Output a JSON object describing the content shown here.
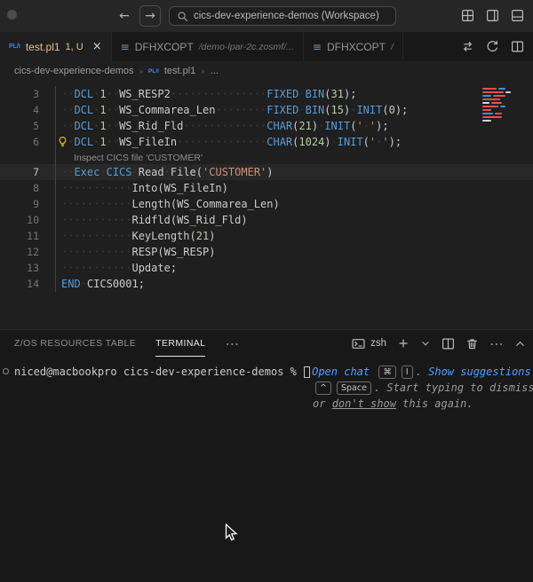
{
  "icons": {
    "back": "←",
    "forward": "→",
    "close": "×",
    "more": "⋯",
    "chevron": "›"
  },
  "colors": {
    "keyword_blue": "#569cd6",
    "number_green": "#b5cea8",
    "string_orange": "#ce9178",
    "modified_tab_gold": "#e2c08d",
    "hint_blue": "#4da0ff",
    "minimap_red": "#f14c4c",
    "accent_blue": "#3b8eea",
    "lightbulb_yellow": "#ffcc02"
  },
  "titlebar": {
    "search_text": "cics-dev-experience-demos (Workspace)"
  },
  "tabs": [
    {
      "icon": "PL/I",
      "label": "test.pl1",
      "badge": "1, U",
      "active": true
    },
    {
      "icon": "≡",
      "label": "DFHXCOPT",
      "desc": "/demo-lpar-2c.zosmf/...",
      "active": false
    },
    {
      "icon": "≡",
      "label": "DFHXCOPT",
      "desc": "/",
      "active": false
    }
  ],
  "breadcrumb": [
    {
      "label": "cics-dev-experience-demos"
    },
    {
      "label": "test.pl1",
      "icon": "PL/I"
    },
    {
      "label": "..."
    }
  ],
  "editor": {
    "rows": [
      {
        "type": "code",
        "num": "3",
        "seg": [
          [
            "ws",
            "··"
          ],
          [
            "kw",
            "DCL"
          ],
          [
            "ws",
            "·"
          ],
          [
            "num",
            "1"
          ],
          [
            "ws",
            "··"
          ],
          [
            "id",
            "WS_RESP2"
          ],
          [
            "ws",
            "···············"
          ],
          [
            "kw",
            "FIXED"
          ],
          [
            "ws",
            "·"
          ],
          [
            "kw",
            "BIN"
          ],
          [
            "pun",
            "("
          ],
          [
            "num",
            "31"
          ],
          [
            "pun",
            ");"
          ]
        ]
      },
      {
        "type": "code",
        "num": "4",
        "seg": [
          [
            "ws",
            "··"
          ],
          [
            "kw",
            "DCL"
          ],
          [
            "ws",
            "·"
          ],
          [
            "num",
            "1"
          ],
          [
            "ws",
            "··"
          ],
          [
            "id",
            "WS_Commarea_Len"
          ],
          [
            "ws",
            "········"
          ],
          [
            "kw",
            "FIXED"
          ],
          [
            "ws",
            "·"
          ],
          [
            "kw",
            "BIN"
          ],
          [
            "pun",
            "("
          ],
          [
            "num",
            "15"
          ],
          [
            "pun",
            ")"
          ],
          [
            "ws",
            "·"
          ],
          [
            "kw",
            "INIT"
          ],
          [
            "pun",
            "("
          ],
          [
            "num",
            "0"
          ],
          [
            "pun",
            ");"
          ]
        ]
      },
      {
        "type": "code",
        "num": "5",
        "seg": [
          [
            "ws",
            "··"
          ],
          [
            "kw",
            "DCL"
          ],
          [
            "ws",
            "·"
          ],
          [
            "num",
            "1"
          ],
          [
            "ws",
            "··"
          ],
          [
            "id",
            "WS_Rid_Fld"
          ],
          [
            "ws",
            "·············"
          ],
          [
            "kw",
            "CHAR"
          ],
          [
            "pun",
            "("
          ],
          [
            "num",
            "21"
          ],
          [
            "pun",
            ")"
          ],
          [
            "ws",
            "·"
          ],
          [
            "kw",
            "INIT"
          ],
          [
            "pun",
            "("
          ],
          [
            "str",
            "'"
          ],
          [
            "ws",
            "·"
          ],
          [
            "str",
            "'"
          ],
          [
            "pun",
            ");"
          ]
        ]
      },
      {
        "type": "code",
        "num": "6",
        "bulb": true,
        "seg": [
          [
            "ws",
            "··"
          ],
          [
            "kw",
            "DCL"
          ],
          [
            "ws",
            "·"
          ],
          [
            "num",
            "1"
          ],
          [
            "ws",
            "··"
          ],
          [
            "id",
            "WS_FileIn"
          ],
          [
            "ws",
            "··············"
          ],
          [
            "kw",
            "CHAR"
          ],
          [
            "pun",
            "("
          ],
          [
            "num",
            "1024"
          ],
          [
            "pun",
            ")"
          ],
          [
            "ws",
            "·"
          ],
          [
            "kw",
            "INIT"
          ],
          [
            "pun",
            "("
          ],
          [
            "str",
            "'"
          ],
          [
            "ws",
            "·"
          ],
          [
            "str",
            "'"
          ],
          [
            "pun",
            ");"
          ]
        ]
      },
      {
        "type": "lens",
        "text": "Inspect CICS file 'CUSTOMER'"
      },
      {
        "type": "code",
        "num": "7",
        "current": true,
        "seg": [
          [
            "ws",
            "··"
          ],
          [
            "kw",
            "Exec"
          ],
          [
            "ws",
            "·"
          ],
          [
            "kw",
            "CICS"
          ],
          [
            "ws",
            "·"
          ],
          [
            "id",
            "Read"
          ],
          [
            "ws",
            "·"
          ],
          [
            "id",
            "File"
          ],
          [
            "pun",
            "("
          ],
          [
            "str",
            "'CUSTOMER'"
          ],
          [
            "pun",
            ")"
          ]
        ]
      },
      {
        "type": "code",
        "num": "8",
        "seg": [
          [
            "ws",
            "···········"
          ],
          [
            "id",
            "Into"
          ],
          [
            "pun",
            "("
          ],
          [
            "id",
            "WS_FileIn"
          ],
          [
            "pun",
            ")"
          ]
        ]
      },
      {
        "type": "code",
        "num": "9",
        "seg": [
          [
            "ws",
            "···········"
          ],
          [
            "id",
            "Length"
          ],
          [
            "pun",
            "("
          ],
          [
            "id",
            "WS_Commarea_Len"
          ],
          [
            "pun",
            ")"
          ]
        ]
      },
      {
        "type": "code",
        "num": "10",
        "seg": [
          [
            "ws",
            "···········"
          ],
          [
            "id",
            "Ridfld"
          ],
          [
            "pun",
            "("
          ],
          [
            "id",
            "WS_Rid_Fld"
          ],
          [
            "pun",
            ")"
          ]
        ]
      },
      {
        "type": "code",
        "num": "11",
        "seg": [
          [
            "ws",
            "···········"
          ],
          [
            "id",
            "KeyLength"
          ],
          [
            "pun",
            "("
          ],
          [
            "num",
            "21"
          ],
          [
            "pun",
            ")"
          ]
        ]
      },
      {
        "type": "code",
        "num": "12",
        "seg": [
          [
            "ws",
            "···········"
          ],
          [
            "id",
            "RESP"
          ],
          [
            "pun",
            "("
          ],
          [
            "id",
            "WS_RESP"
          ],
          [
            "pun",
            ")"
          ]
        ]
      },
      {
        "type": "code",
        "num": "13",
        "seg": [
          [
            "ws",
            "···········"
          ],
          [
            "id",
            "Update"
          ],
          [
            "pun",
            ";"
          ]
        ]
      },
      {
        "type": "code",
        "num": "14",
        "seg": [
          [
            "kw",
            "END"
          ],
          [
            "ws",
            "·"
          ],
          [
            "id",
            "CICS0001"
          ],
          [
            "pun",
            ";"
          ]
        ]
      }
    ],
    "minimap": [
      [
        [
          "#f14c4c",
          16
        ],
        [
          "#3b8eea",
          8
        ]
      ],
      [
        [
          "#f14c4c",
          24
        ],
        [
          "#d4d4d4",
          6
        ]
      ],
      [
        [
          "#3b8eea",
          10
        ],
        [
          "#f14c4c",
          14
        ]
      ],
      [
        [
          "#f14c4c",
          20
        ]
      ],
      [
        [
          "#d4d4d4",
          8
        ],
        [
          "#f14c4c",
          12
        ]
      ],
      [
        [
          "#f14c4c",
          18
        ],
        [
          "#3b8eea",
          6
        ]
      ],
      [
        [
          "#f14c4c",
          10
        ]
      ],
      [
        [
          "#3b8eea",
          12
        ],
        [
          "#f14c4c",
          8
        ]
      ],
      [
        [
          "#f14c4c",
          22
        ]
      ],
      [
        [
          "#d4d4d4",
          10
        ]
      ]
    ]
  },
  "panel": {
    "tabs": [
      {
        "label": "Z/OS RESOURCES TABLE",
        "active": false
      },
      {
        "label": "TERMINAL",
        "active": true
      }
    ],
    "more": "⋯",
    "shell_label": "zsh",
    "terminal": {
      "lines": [
        {
          "decorated": true,
          "seg": [
            [
              "t",
              "niced@macbookpro cics-dev-experience-demos % "
            ],
            [
              "cursor",
              ""
            ],
            [
              "b",
              "Open chat "
            ],
            [
              "k",
              "⌘"
            ],
            [
              "k",
              "I"
            ],
            [
              "b",
              ". Show suggestions"
            ]
          ]
        },
        {
          "cont": true,
          "seg": [
            [
              "k",
              "^"
            ],
            [
              "k",
              "Space"
            ],
            [
              "g",
              ". Start typing to dismiss"
            ]
          ]
        },
        {
          "cont": true,
          "seg": [
            [
              "g",
              "or "
            ],
            [
              "gl",
              "don't show"
            ],
            [
              "g",
              " this again."
            ]
          ]
        }
      ]
    }
  }
}
